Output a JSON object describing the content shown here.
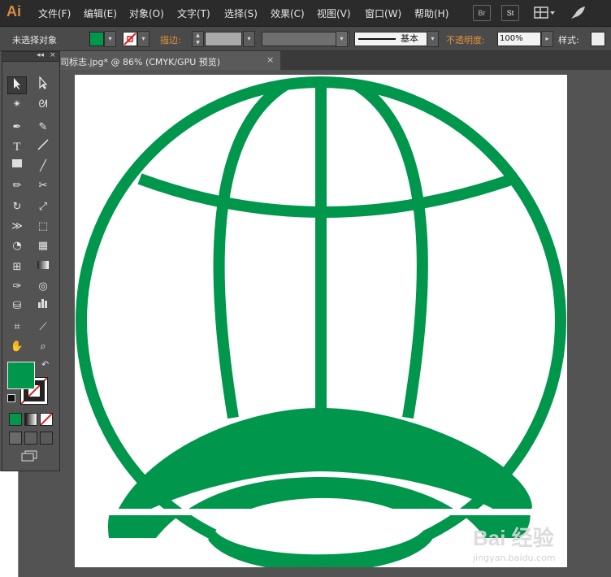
{
  "app": {
    "logo": "Ai"
  },
  "menu": {
    "items": [
      "文件(F)",
      "编辑(E)",
      "对象(O)",
      "文字(T)",
      "选择(S)",
      "效果(C)",
      "视图(V)",
      "窗口(W)",
      "帮助(H)"
    ]
  },
  "menu_buttons": {
    "br": "Br",
    "st": "St"
  },
  "control": {
    "selection": "未选择对象",
    "stroke_label": "描边:",
    "stroke_profile": "基本",
    "opacity_label": "不透明度:",
    "opacity_value": "100%",
    "style_label": "样式:",
    "fill_color": "#00964b"
  },
  "document": {
    "tab_title": "司标志.jpg* @ 86% (CMYK/GPU 预览)",
    "close": "×"
  },
  "toolbox": {
    "collapse": "◂◂",
    "close": "×",
    "fill_color": "#00964b"
  },
  "artwork": {
    "color": "#00964b"
  },
  "watermark": {
    "main": "Bai 经验",
    "sub": "jingyan.baidu.com"
  }
}
